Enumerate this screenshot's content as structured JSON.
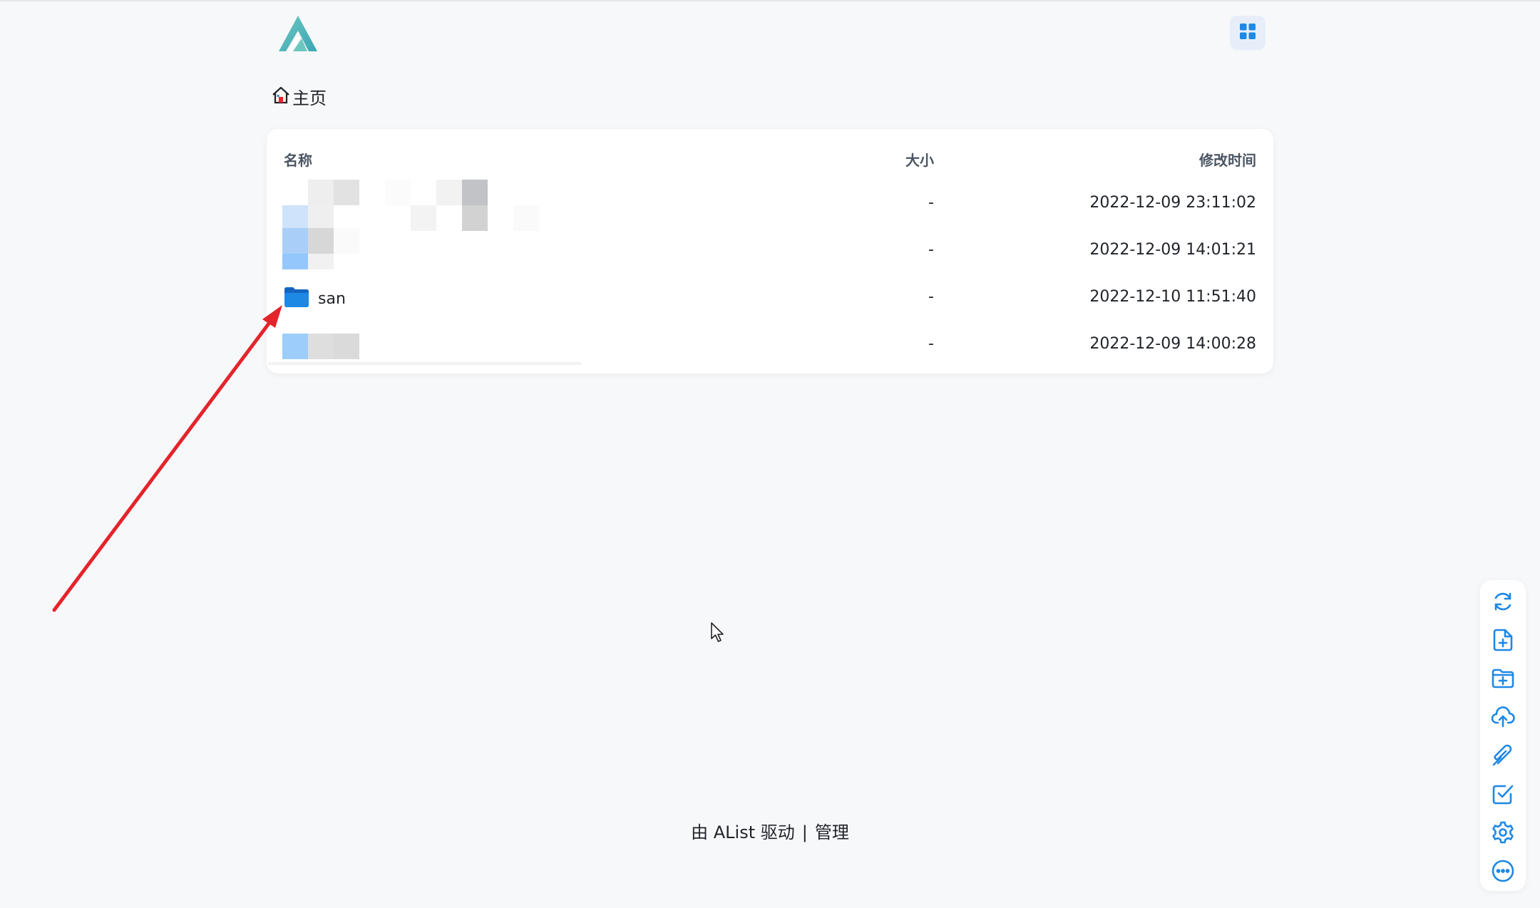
{
  "header": {
    "logo_icon": "alist-logo-icon",
    "layout_toggle_icon": "grid-icon"
  },
  "breadcrumb": {
    "home_icon": "home-icon",
    "label": "主页"
  },
  "table": {
    "columns": {
      "name": "名称",
      "size": "大小",
      "modified": "修改时间"
    },
    "rows": [
      {
        "name": "",
        "name_redacted": true,
        "size": "-",
        "modified": "2022-12-09 23:11:02"
      },
      {
        "name": "",
        "name_redacted": true,
        "size": "-",
        "modified": "2022-12-09 14:01:21"
      },
      {
        "name": "san",
        "icon": "folder-icon",
        "size": "-",
        "modified": "2022-12-10 11:51:40"
      },
      {
        "name": "",
        "name_redacted": true,
        "size": "-",
        "modified": "2022-12-09 14:00:28"
      }
    ]
  },
  "footer": {
    "powered": "由 AList 驱动",
    "separator": "|",
    "manage": "管理"
  },
  "toolbar": {
    "items": [
      "refresh-icon",
      "new-file-icon",
      "new-folder-icon",
      "upload-icon",
      "offline-download-icon",
      "select-icon",
      "settings-icon",
      "more-icon"
    ]
  },
  "colors": {
    "accent": "#1e88e5",
    "background": "#f7f8fa",
    "annotation_arrow": "#e3242b"
  }
}
